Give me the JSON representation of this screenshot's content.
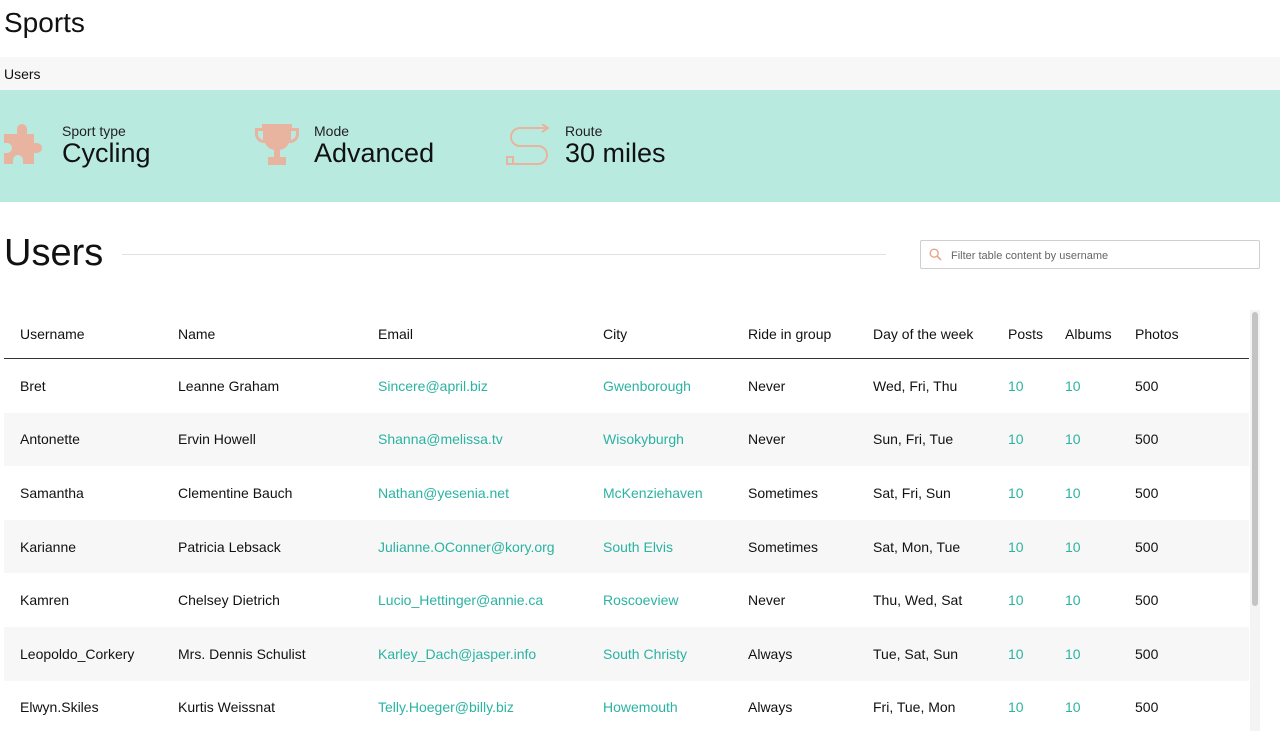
{
  "app": {
    "title": "Sports"
  },
  "breadcrumb": {
    "label": "Users"
  },
  "stats": [
    {
      "icon": "puzzle-icon",
      "label": "Sport type",
      "value": "Cycling"
    },
    {
      "icon": "trophy-icon",
      "label": "Mode",
      "value": "Advanced"
    },
    {
      "icon": "route-icon",
      "label": "Route",
      "value": "30 miles"
    }
  ],
  "colors": {
    "banner": "#b9eae0",
    "icon": "#e8b4a0",
    "link": "#2bb3a2"
  },
  "users_section": {
    "title": "Users",
    "search_placeholder": "Filter table content by username",
    "columns": [
      "Username",
      "Name",
      "Email",
      "City",
      "Ride in group",
      "Day of the week",
      "Posts",
      "Albums",
      "Photos"
    ],
    "rows": [
      [
        "Bret",
        "Leanne Graham",
        "Sincere@april.biz",
        "Gwenborough",
        "Never",
        "Wed, Fri, Thu",
        "10",
        "10",
        "500"
      ],
      [
        "Antonette",
        "Ervin Howell",
        "Shanna@melissa.tv",
        "Wisokyburgh",
        "Never",
        "Sun, Fri, Tue",
        "10",
        "10",
        "500"
      ],
      [
        "Samantha",
        "Clementine Bauch",
        "Nathan@yesenia.net",
        "McKenziehaven",
        "Sometimes",
        "Sat, Fri, Sun",
        "10",
        "10",
        "500"
      ],
      [
        "Karianne",
        "Patricia Lebsack",
        "Julianne.OConner@kory.org",
        "South Elvis",
        "Sometimes",
        "Sat, Mon, Tue",
        "10",
        "10",
        "500"
      ],
      [
        "Kamren",
        "Chelsey Dietrich",
        "Lucio_Hettinger@annie.ca",
        "Roscoeview",
        "Never",
        "Thu, Wed, Sat",
        "10",
        "10",
        "500"
      ],
      [
        "Leopoldo_Corkery",
        "Mrs. Dennis Schulist",
        "Karley_Dach@jasper.info",
        "South Christy",
        "Always",
        "Tue, Sat, Sun",
        "10",
        "10",
        "500"
      ],
      [
        "Elwyn.Skiles",
        "Kurtis Weissnat",
        "Telly.Hoeger@billy.biz",
        "Howemouth",
        "Always",
        "Fri, Tue, Mon",
        "10",
        "10",
        "500"
      ]
    ]
  }
}
